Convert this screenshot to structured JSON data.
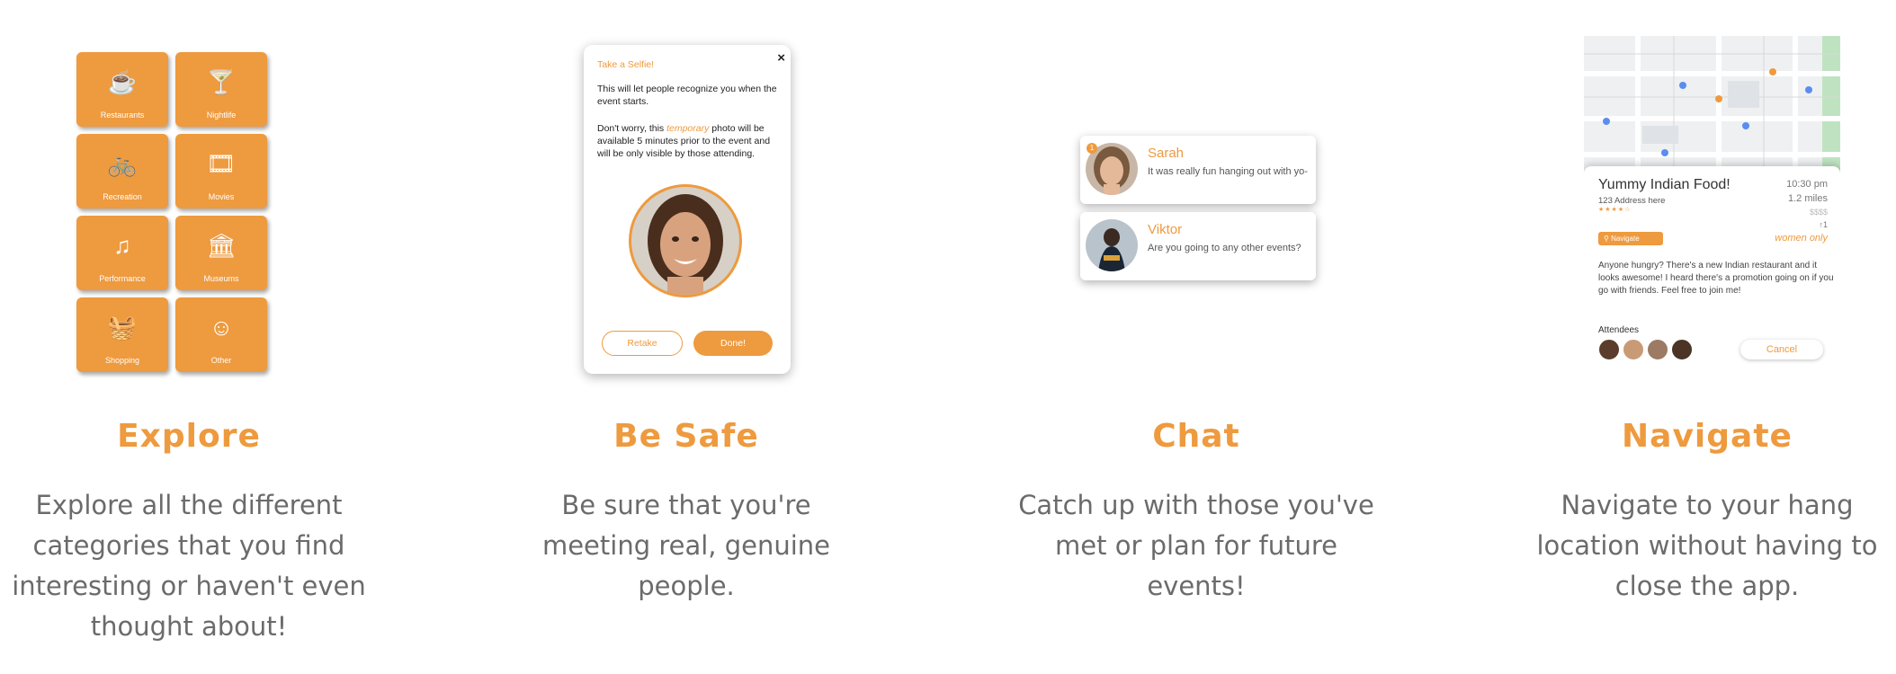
{
  "colors": {
    "accent": "#ee9a3e",
    "text": "#6b6b6b"
  },
  "explore": {
    "title": "Explore",
    "desc": "Explore all the different categories that you find interesting or haven't even thought about!",
    "tiles": [
      {
        "label": "Restaurants",
        "icon": "coffee-cup-icon",
        "glyph": "☕"
      },
      {
        "label": "Nightlife",
        "icon": "cocktail-glass-icon",
        "glyph": "🍸"
      },
      {
        "label": "Recreation",
        "icon": "bicycle-icon",
        "glyph": "🚲"
      },
      {
        "label": "Movies",
        "icon": "film-icon",
        "glyph": "🎞"
      },
      {
        "label": "Performance",
        "icon": "music-library-icon",
        "glyph": "♫"
      },
      {
        "label": "Museums",
        "icon": "museum-icon",
        "glyph": "🏛"
      },
      {
        "label": "Shopping",
        "icon": "basket-icon",
        "glyph": "🧺"
      },
      {
        "label": "Other",
        "icon": "smiley-icon",
        "glyph": "☺"
      }
    ]
  },
  "safe": {
    "title": "Be Safe",
    "desc": "Be sure that you're meeting real, genuine people.",
    "dialog": {
      "title": "Take a Selfie!",
      "close": "×",
      "p1": "This will let people recognize you when the event starts.",
      "p2_before": "Don't worry, this ",
      "p2_em": "temporary",
      "p2_after": " photo will be available 5 minutes prior to the event and will be only visible by those attending.",
      "retake": "Retake",
      "done": "Done!"
    }
  },
  "chat": {
    "title": "Chat",
    "desc": "Catch up with those you've met or plan for future events!",
    "items": [
      {
        "name": "Sarah",
        "message": "It was really fun hanging out with yo-",
        "badge": "1"
      },
      {
        "name": "Viktor",
        "message": "Are you going to any other events?"
      }
    ]
  },
  "navigate": {
    "title": "Navigate",
    "desc": "Navigate to your hang location without having to close the app.",
    "card": {
      "name": "Yummy Indian Food!",
      "address": "123 Address here",
      "stars": "★★★★☆",
      "time": "10:30 pm",
      "distance": "1.2 miles",
      "price": "$$$$",
      "count": "↑1",
      "tag": "women only",
      "navigate_label": "Navigate",
      "description": "Anyone hungry? There's a new Indian restaurant and it looks awesome! I heard there's a promotion going on if you go with friends. Feel free to join me!",
      "attendees_label": "Attendees",
      "cancel_label": "Cancel"
    }
  }
}
